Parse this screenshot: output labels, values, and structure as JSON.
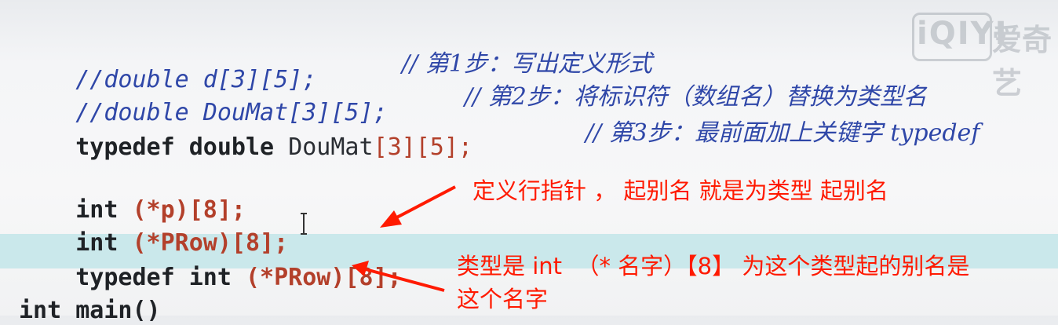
{
  "code": {
    "line1_code": "//double d[3][5];",
    "line1_comment": "// 第1步：写出定义形式",
    "line2_code": "//double DouMat[3][5];",
    "line2_comment": "// 第2步：将标识符（数组名）替换为类型名",
    "line3_kw1": "typedef",
    "line3_kw2": "double",
    "line3_ident": "DouMat",
    "line3_dims": "[3][5];",
    "line3_comment": "// 第3步：最前面加上关键字 typedef",
    "line5_kw": "int",
    "line5_rest": "(*p)[8];",
    "line6_kw": "int",
    "line6_rest": "(*PRow)[8];",
    "line7_kw1": "typedef",
    "line7_kw2": "int",
    "line7_rest": "(*PRow)[8];",
    "line9_partial": "int main()"
  },
  "annotations": {
    "top": "定义行指针 ， 起别名 就是为类型 起别名",
    "bottom_line1": "类型是 int  （* 名字）【8】 为这个类型起的别名是",
    "bottom_line2": "这个名字"
  },
  "watermark": {
    "brand": "iQIYI",
    "brand_cn": "爱奇艺"
  },
  "colors": {
    "comment": "#2f47a8",
    "keyword": "#1f2226",
    "punctuation": "#b3402b",
    "annotation": "#ff1a00",
    "line_highlight": "#bfe5e9"
  }
}
